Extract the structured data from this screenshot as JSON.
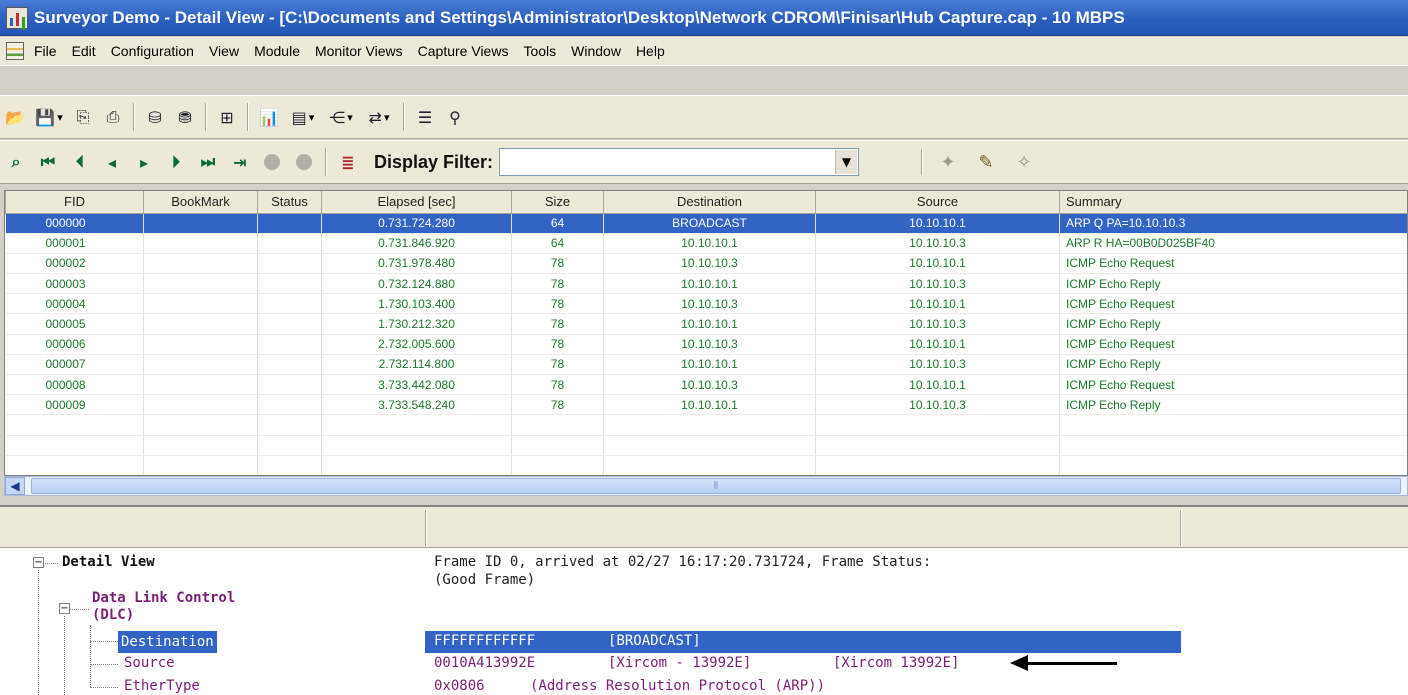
{
  "window": {
    "title": "Surveyor Demo - Detail View - [C:\\Documents and Settings\\Administrator\\Desktop\\Network CDROM\\Finisar\\Hub Capture.cap - 10 MBPS"
  },
  "menu": [
    "File",
    "Edit",
    "Configuration",
    "View",
    "Module",
    "Monitor Views",
    "Capture Views",
    "Tools",
    "Window",
    "Help"
  ],
  "filter": {
    "label": "Display Filter:",
    "value": ""
  },
  "grid": {
    "columns": [
      "FID",
      "BookMark",
      "Status",
      "Elapsed [sec]",
      "Size",
      "Destination",
      "Source",
      "Summary"
    ],
    "rows": [
      {
        "fid": "000000",
        "bookmark": "",
        "status": "",
        "elapsed": "0.731.724.280",
        "size": "64",
        "dest": "BROADCAST",
        "source": "10.10.10.1",
        "summary": "ARP  Q PA=10.10.10.3"
      },
      {
        "fid": "000001",
        "bookmark": "",
        "status": "",
        "elapsed": "0.731.846.920",
        "size": "64",
        "dest": "10.10.10.1",
        "source": "10.10.10.3",
        "summary": "ARP  R HA=00B0D025BF40"
      },
      {
        "fid": "000002",
        "bookmark": "",
        "status": "",
        "elapsed": "0.731.978.480",
        "size": "78",
        "dest": "10.10.10.3",
        "source": "10.10.10.1",
        "summary": "ICMP  Echo Request"
      },
      {
        "fid": "000003",
        "bookmark": "",
        "status": "",
        "elapsed": "0.732.124.880",
        "size": "78",
        "dest": "10.10.10.1",
        "source": "10.10.10.3",
        "summary": "ICMP  Echo Reply"
      },
      {
        "fid": "000004",
        "bookmark": "",
        "status": "",
        "elapsed": "1.730.103.400",
        "size": "78",
        "dest": "10.10.10.3",
        "source": "10.10.10.1",
        "summary": "ICMP  Echo Request"
      },
      {
        "fid": "000005",
        "bookmark": "",
        "status": "",
        "elapsed": "1.730.212.320",
        "size": "78",
        "dest": "10.10.10.1",
        "source": "10.10.10.3",
        "summary": "ICMP  Echo Reply"
      },
      {
        "fid": "000006",
        "bookmark": "",
        "status": "",
        "elapsed": "2.732.005.600",
        "size": "78",
        "dest": "10.10.10.3",
        "source": "10.10.10.1",
        "summary": "ICMP  Echo Request"
      },
      {
        "fid": "000007",
        "bookmark": "",
        "status": "",
        "elapsed": "2.732.114.800",
        "size": "78",
        "dest": "10.10.10.1",
        "source": "10.10.10.3",
        "summary": "ICMP  Echo Reply"
      },
      {
        "fid": "000008",
        "bookmark": "",
        "status": "",
        "elapsed": "3.733.442.080",
        "size": "78",
        "dest": "10.10.10.3",
        "source": "10.10.10.1",
        "summary": "ICMP  Echo Request"
      },
      {
        "fid": "000009",
        "bookmark": "",
        "status": "",
        "elapsed": "3.733.548.240",
        "size": "78",
        "dest": "10.10.10.1",
        "source": "10.10.10.3",
        "summary": "ICMP  Echo Reply"
      }
    ]
  },
  "detail": {
    "root_label": "Detail View",
    "frame_info_line1": "Frame ID 0, arrived at 02/27 16:17:20.731724, Frame Status:",
    "frame_info_line2": "(Good Frame)",
    "dlc_label_line1": "Data Link Control",
    "dlc_label_line2": "(DLC)",
    "fields": [
      {
        "name": "Destination",
        "value": "FFFFFFFFFFFF",
        "desc": "[BROADCAST]",
        "extra": ""
      },
      {
        "name": "Source",
        "value": "0010A413992E",
        "desc": "[Xircom - 13992E]",
        "extra": "[Xircom 13992E]"
      },
      {
        "name": "EtherType",
        "value": "0x0806",
        "desc": "(Address Resolution Protocol (ARP))",
        "extra": ""
      }
    ]
  }
}
